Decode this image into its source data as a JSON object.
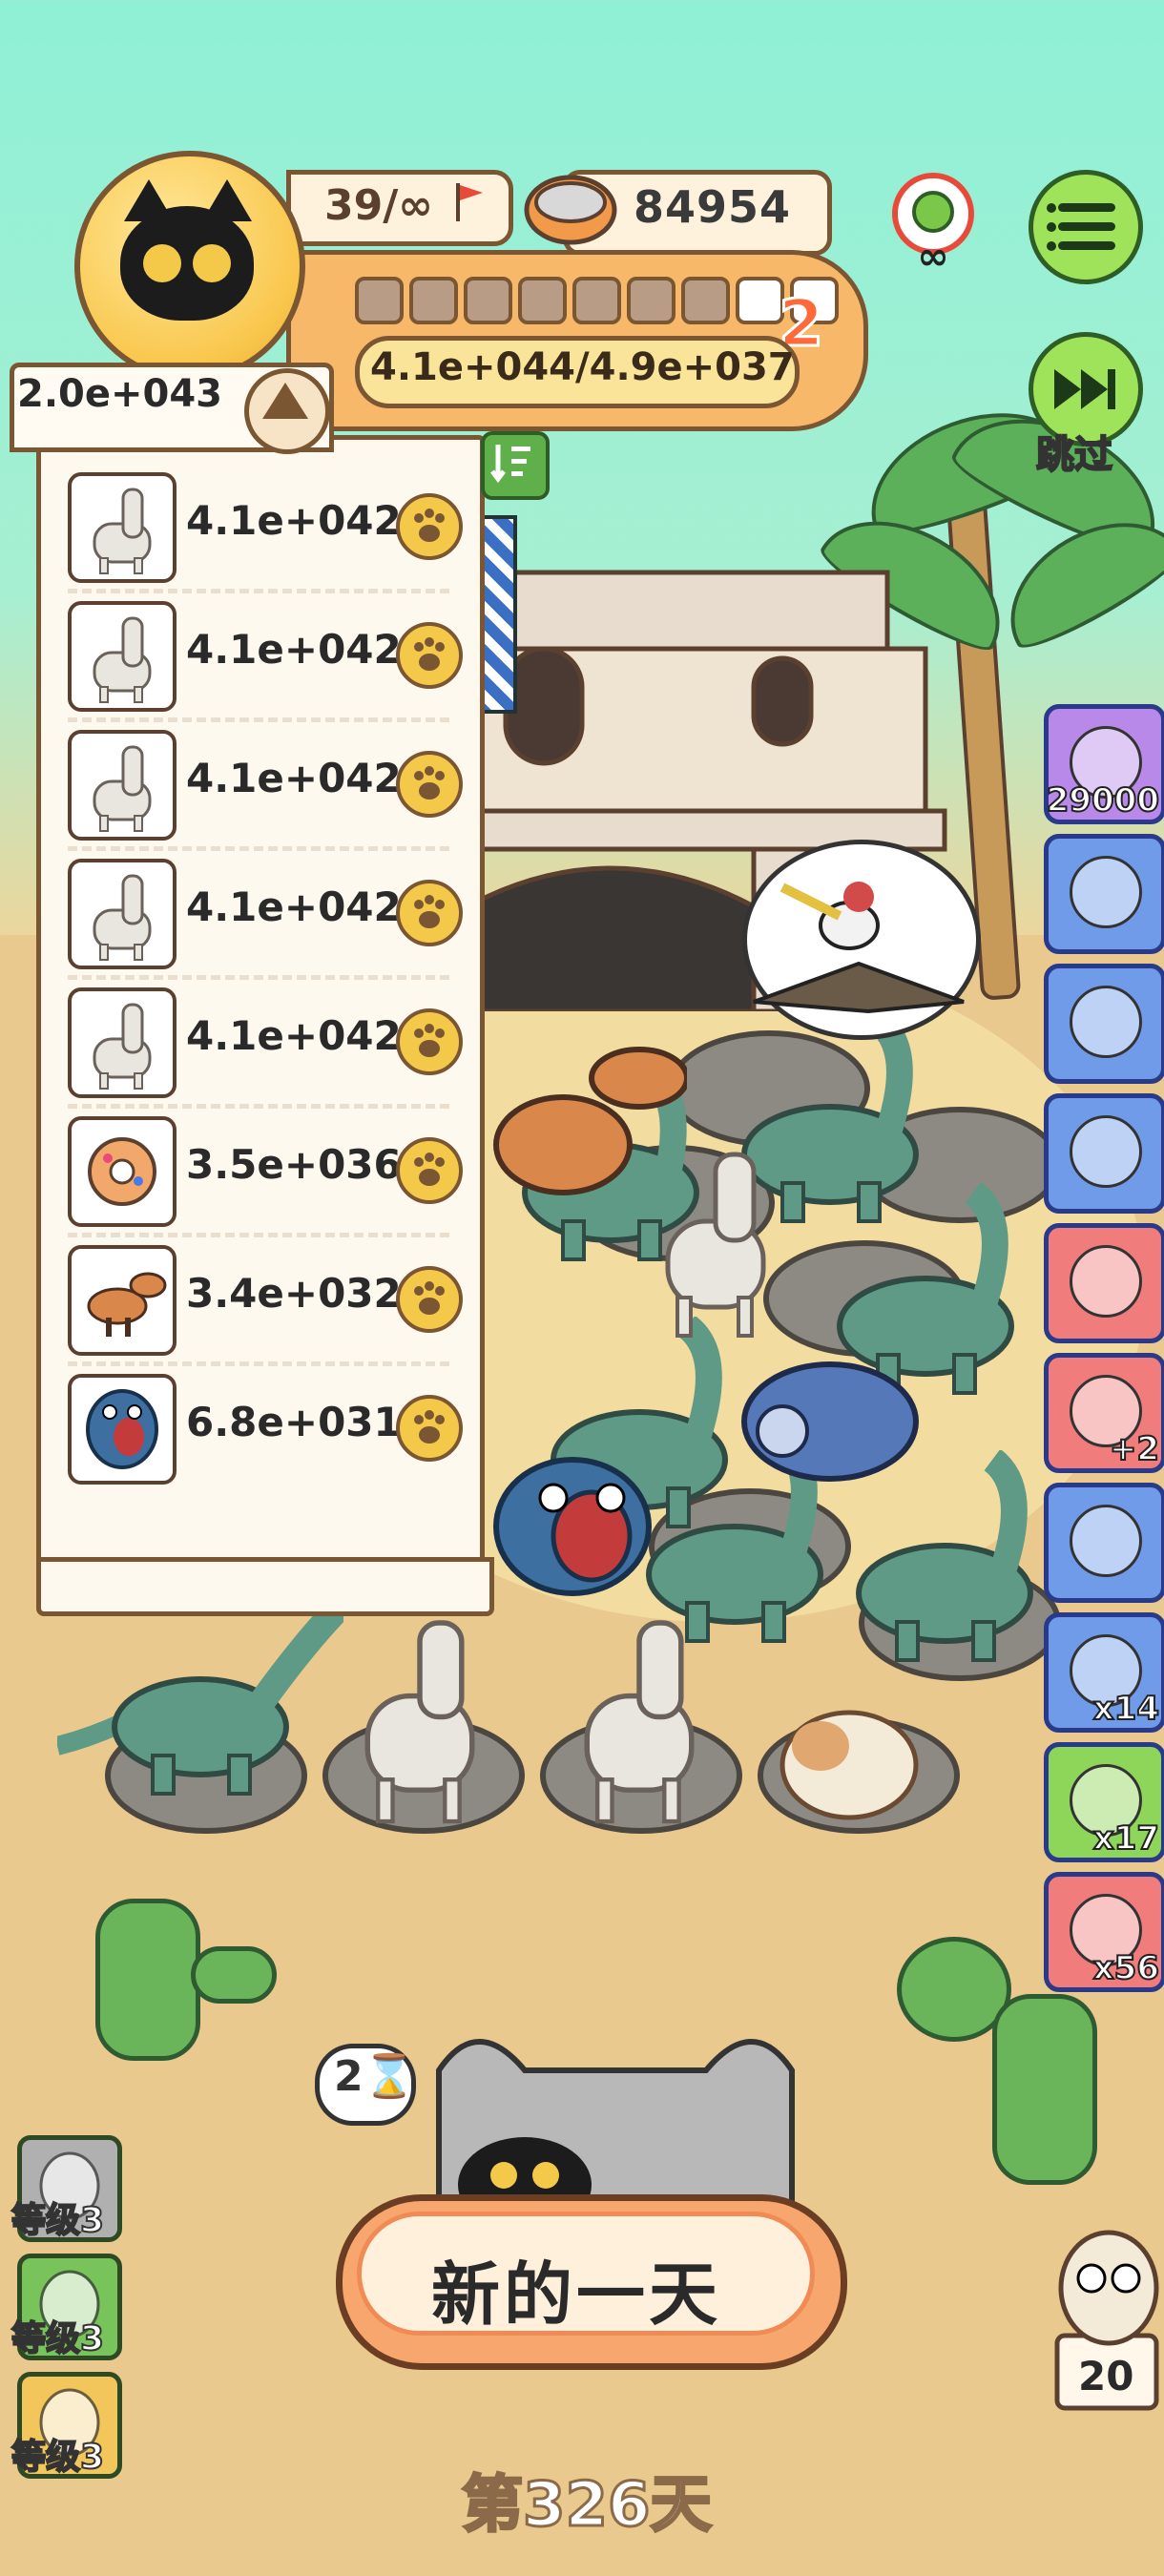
{
  "header": {
    "level_text": "39/∞",
    "coins": "84954",
    "xp_text": "4.1e+044/4.9e+037",
    "level_badge": "2",
    "segments_filled": 7,
    "segments_total": 9
  },
  "controls": {
    "skip_label": "跳过"
  },
  "list": {
    "total": "2.0e+043",
    "rows": [
      {
        "icon": "alpaca-icon",
        "value": "4.1e+042"
      },
      {
        "icon": "alpaca-icon",
        "value": "4.1e+042"
      },
      {
        "icon": "alpaca-icon",
        "value": "4.1e+042"
      },
      {
        "icon": "alpaca-icon",
        "value": "4.1e+042"
      },
      {
        "icon": "alpaca-icon",
        "value": "4.1e+042"
      },
      {
        "icon": "donut-icon",
        "value": "3.5e+036"
      },
      {
        "icon": "raptor-icon",
        "value": "3.4e+032"
      },
      {
        "icon": "blue-dino-icon",
        "value": "6.8e+031"
      }
    ]
  },
  "side_items": [
    {
      "icon": "nut-icon",
      "label": "29000",
      "color": "#b889e8"
    },
    {
      "icon": "camera-icon",
      "label": "",
      "color": "#6f9be8"
    },
    {
      "icon": "jar-icon",
      "label": "",
      "color": "#6f9be8"
    },
    {
      "icon": "sheep-hat-icon",
      "label": "",
      "color": "#6f9be8"
    },
    {
      "icon": "tools-icon",
      "label": "",
      "color": "#f07c7c"
    },
    {
      "icon": "bag-icon",
      "label": "+2",
      "color": "#f07c7c"
    },
    {
      "icon": "leaf-pot-icon",
      "label": "",
      "color": "#6f9be8"
    },
    {
      "icon": "donut-icon",
      "label": "x14",
      "color": "#6f9be8"
    },
    {
      "icon": "tent-icon",
      "label": "x17",
      "color": "#8ed65a"
    },
    {
      "icon": "hose-icon",
      "label": "x56",
      "color": "#f07c7c"
    }
  ],
  "bottom": {
    "speech_text": "2⌛",
    "new_day_label": "新的一天",
    "day_label": "第326天",
    "right_card_count": "20",
    "level_items": [
      {
        "icon": "ghost-icon",
        "label": "等级3",
        "color": "#b0b0b0"
      },
      {
        "icon": "ghost-icon",
        "label": "等级3",
        "color": "#79c45a"
      },
      {
        "icon": "cookie-icon",
        "label": "等级3",
        "color": "#f2c65a"
      }
    ]
  }
}
